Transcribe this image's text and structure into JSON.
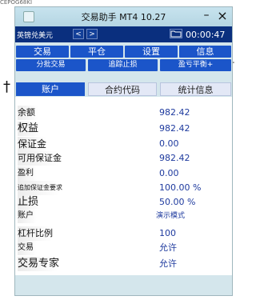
{
  "window": {
    "title": "交易助手 MT4 10.27",
    "min_symbol": "–",
    "close_symbol": "×"
  },
  "top_fragment": "CEPOG68KI",
  "toolbar": {
    "symbol": "英镑兑美元",
    "prev": "<",
    "next": ">",
    "time": "00:00:47"
  },
  "buttons": {
    "trade": "交易",
    "close_position": "平仓",
    "settings": "设置",
    "info": "信息",
    "partial_trade": "分批交易",
    "trailing_stop": "追踪止损",
    "breakeven": "盈亏平衡+"
  },
  "tabs": {
    "account": "账户",
    "contract_code": "合约代码",
    "statistics": "统计信息"
  },
  "account": {
    "rows": [
      {
        "label": "余额",
        "value": "982.42"
      },
      {
        "label": "权益",
        "value": "982.42"
      },
      {
        "label": "保证金",
        "value": "0.00"
      },
      {
        "label": "可用保证金",
        "value": "982.42"
      },
      {
        "label": "盈利",
        "value": "0.00"
      },
      {
        "label": "追加保证金要求",
        "value": "100.00 %"
      },
      {
        "label": "止损",
        "value": "50.00 %"
      },
      {
        "label": "账户",
        "value": "演示模式"
      },
      {
        "label": "杠杆比例",
        "value": "100"
      },
      {
        "label": "交易",
        "value": "允许"
      },
      {
        "label": "交易专家",
        "value": "允许"
      }
    ]
  },
  "decor": {
    "left_cross": "†",
    "right_cross": "†"
  }
}
